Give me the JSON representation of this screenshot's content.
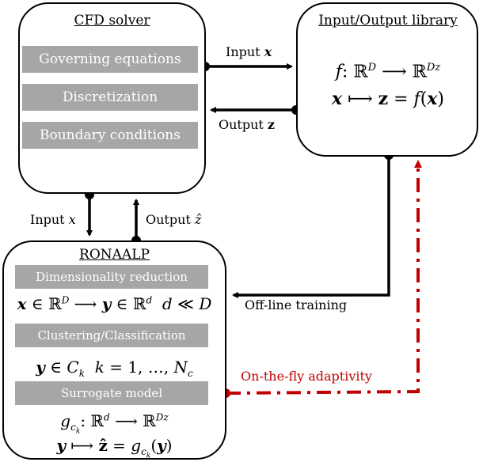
{
  "cfd_solver": {
    "title": "CFD solver",
    "blocks": [
      "Governing equations",
      "Discretization",
      "Boundary conditions"
    ]
  },
  "io_library": {
    "title": "Input/Output library",
    "eq1": "f: ℝ^D ⟶ ℝ^Dz",
    "eq2": "x ⟼ z = f(x)"
  },
  "ronaalp": {
    "title": "RONAALP",
    "blocks": [
      "Dimensionality reduction",
      "Clustering/Classification",
      "Surrogate model"
    ],
    "eq_reduction": "x ∈ ℝ^D ⟶ y ∈ ℝ^d  d ≪ D",
    "eq_cluster": "y ∈ C_k  k = 1, …, N_c",
    "eq_surrogate1": "g_ck: ℝ^d ⟶ ℝ^Dz",
    "eq_surrogate2": "y ⟼ ẑ = g_ck(y)"
  },
  "arrows": {
    "input_x_top": "Input",
    "output_z_top": "Output",
    "input_x_left": "Input",
    "output_zhat": "Output",
    "offline": "Off-line training",
    "adaptivity": "On-the-fly adaptivity"
  },
  "colors": {
    "block_gray": "#a6a6a6",
    "adaptivity_red": "#c00000",
    "line": "#000000"
  }
}
